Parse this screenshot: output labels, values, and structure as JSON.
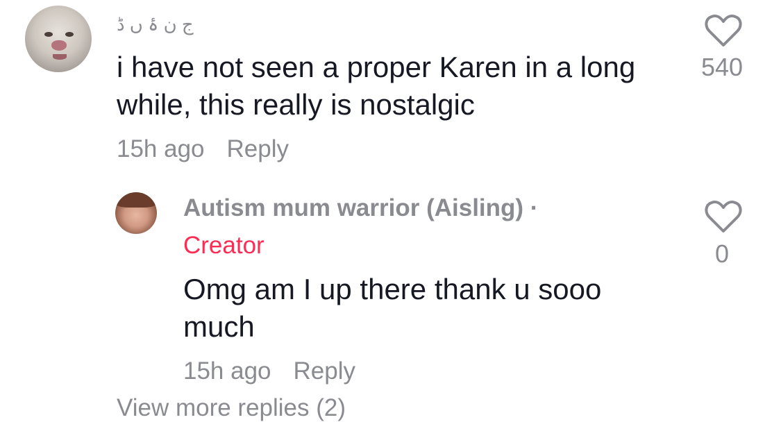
{
  "comments": [
    {
      "username": "ج ن ۂ ں ڈ",
      "text": "i have not seen a proper Karen in a long while, this really is nostalgic",
      "time": "15h ago",
      "reply_label": "Reply",
      "likes": "540"
    }
  ],
  "replies": [
    {
      "username": "Autism mum warrior (Aisling) ·",
      "badge": "Creator",
      "text": "Omg am I up there thank u sooo much",
      "time": "15h ago",
      "reply_label": "Reply",
      "likes": "0"
    }
  ],
  "view_more": "View more replies (2)",
  "colors": {
    "text": "#161823",
    "muted": "#8a8b91",
    "creator": "#fe2c55"
  },
  "icons": [
    "heart-outline-icon"
  ]
}
